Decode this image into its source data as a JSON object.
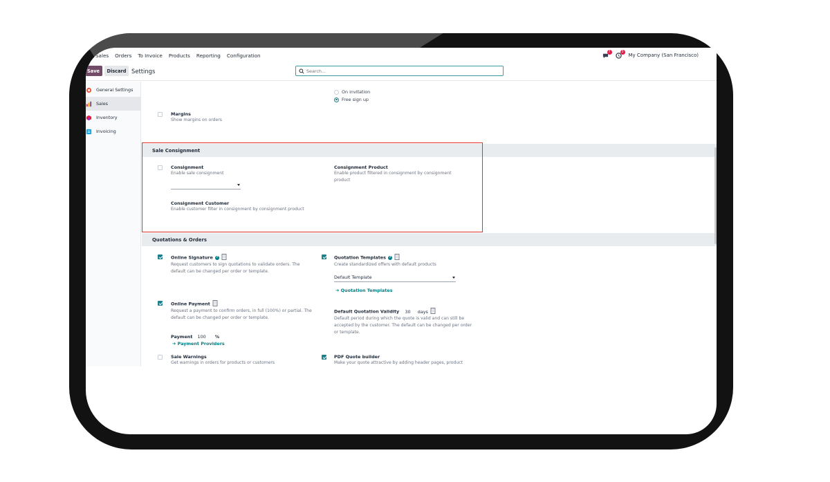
{
  "navbar": {
    "app": "Sales",
    "menu": [
      "Orders",
      "To Invoice",
      "Products",
      "Reporting",
      "Configuration"
    ],
    "messages_count": "7",
    "activities_count": "3",
    "company": "My Company (San Francisco)"
  },
  "control": {
    "save_label": "Save",
    "discard_label": "Discard",
    "title": "Settings",
    "search_placeholder": "Search..."
  },
  "sidebar": {
    "items": [
      {
        "label": "General Settings",
        "icon": "general-settings-icon",
        "color": "#e8563e"
      },
      {
        "label": "Sales",
        "icon": "sales-icon",
        "color": "#f59e0b"
      },
      {
        "label": "Inventory",
        "icon": "inventory-icon",
        "color": "#e11d48"
      },
      {
        "label": "Invoicing",
        "icon": "invoicing-icon",
        "color": "#0ea5e9"
      }
    ]
  },
  "top_area": {
    "radio_options": [
      "On invitation",
      "Free sign up"
    ],
    "radio_selected": "Free sign up",
    "margins": {
      "title": "Margins",
      "desc": "Show margins on orders",
      "checked": false
    }
  },
  "sale_consignment": {
    "heading": "Sale Consignment",
    "consignment": {
      "title": "Consignment",
      "desc": "Enable sale consignment",
      "checked": false,
      "select_value": ""
    },
    "consignment_product": {
      "title": "Consignment Product",
      "desc": "Enable product filtered in consignment by consignment product"
    },
    "consignment_customer": {
      "title": "Consignment Customer",
      "desc": "Enable customer filter in consignment by consignment product"
    }
  },
  "quotations": {
    "heading": "Quotations & Orders",
    "online_signature": {
      "title": "Online Signature",
      "desc": "Request customers to sign quotations to validate orders. The default can be changed per order or template.",
      "checked": true
    },
    "quotation_templates": {
      "title": "Quotation Templates",
      "desc": "Create standardized offers with default products",
      "checked": true,
      "select_value": "Default Template",
      "link": "Quotation Templates"
    },
    "online_payment": {
      "title": "Online Payment",
      "desc": "Request a payment to confirm orders, in full (100%) or partial. The default can be changed per order or template.",
      "checked": true,
      "payment_label": "Payment",
      "payment_value": "100",
      "payment_unit": "%",
      "link": "Payment Providers"
    },
    "default_validity": {
      "title": "Default Quotation Validity",
      "value": "30",
      "unit": "days",
      "desc": "Default period during which the quote is valid and can still be accepted by the customer. The default can be changed per order or template."
    },
    "sale_warnings": {
      "title": "Sale Warnings",
      "desc": "Get warnings in orders for products or customers",
      "checked": false
    },
    "pdf_quote_builder": {
      "title": "PDF Quote builder",
      "desc": "Make your quote attractive by adding header pages, product",
      "checked": true
    }
  },
  "colors": {
    "primary": "#714b67",
    "accent": "#017e84",
    "highlight_border": "#e0312d"
  }
}
